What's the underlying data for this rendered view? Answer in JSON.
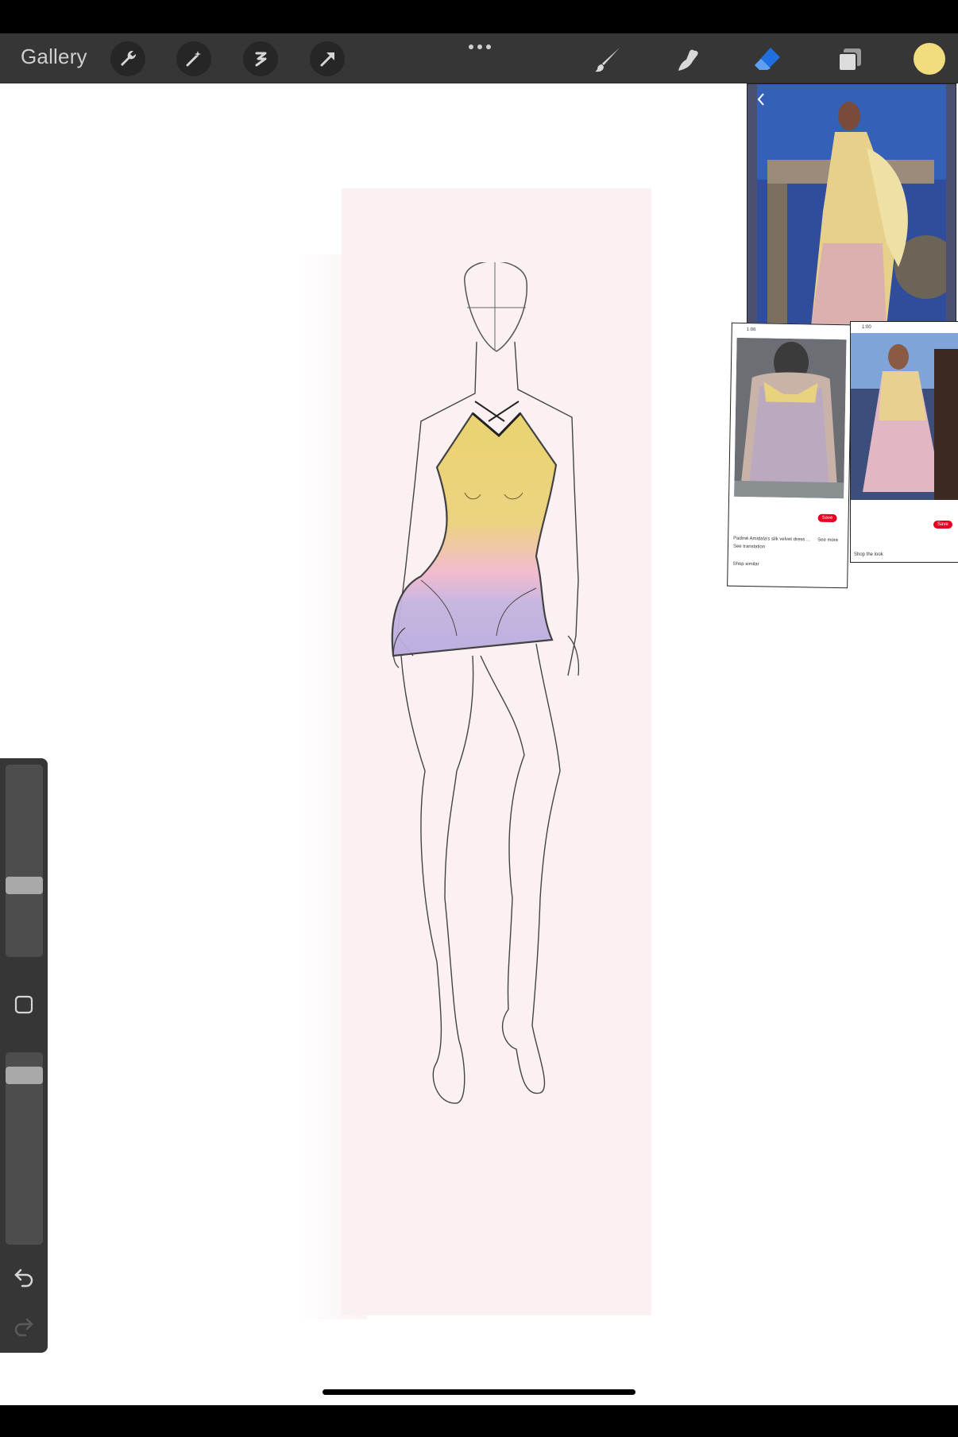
{
  "toolbar": {
    "gallery_label": "Gallery",
    "left_tools": [
      "wrench-icon",
      "magic-wand-icon",
      "selection-icon",
      "transform-arrow-icon"
    ],
    "right_tools": [
      "brush-icon",
      "smudge-icon",
      "eraser-icon",
      "layers-icon"
    ],
    "active_tool": "eraser-icon",
    "current_color": "#F2DD7E"
  },
  "reference_images": {
    "left_screenshot": {
      "status_time": "1:06",
      "save_label": "Save",
      "caption": "Padmé Amidala's silk velvet dress ...",
      "see_more": "See more",
      "see_translation": "See translation",
      "shop_similar": "Shop similar"
    },
    "right_screenshot": {
      "status_time": "1:00",
      "save_label": "Save",
      "shop_the_look": "Shop the look"
    }
  },
  "side_panel": {
    "brush_size_level": 0.36,
    "opacity_level": 0.92,
    "icons": [
      "modify-square-icon",
      "undo-icon",
      "redo-icon"
    ]
  },
  "colors": {
    "toolbar_bg": "#363636",
    "paper": "#FBF1F2",
    "accent_blue": "#1E6FE0",
    "dress_yellow": "#E9D26E",
    "dress_pink": "#F2B8CF",
    "dress_lavender": "#C2B3DF"
  }
}
